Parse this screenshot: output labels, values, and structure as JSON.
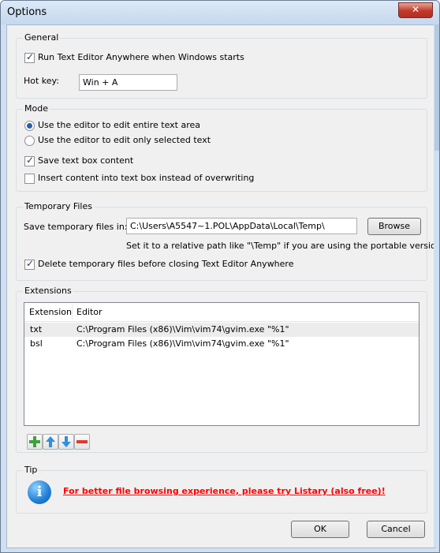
{
  "window": {
    "title": "Options",
    "close_label": "✕"
  },
  "general": {
    "title": "General",
    "run_on_start": {
      "label": "Run Text Editor Anywhere when Windows starts",
      "checked": true
    },
    "hotkey": {
      "label": "Hot key:",
      "value": "Win + A"
    }
  },
  "mode": {
    "title": "Mode",
    "radio_entire": {
      "label": "Use the editor to edit entire text area",
      "selected": true
    },
    "radio_selected": {
      "label": "Use the editor to edit only selected text",
      "selected": false
    },
    "save_content": {
      "label": "Save text box content",
      "checked": true
    },
    "insert_content": {
      "label": "Insert content into text box instead of overwriting",
      "checked": false
    }
  },
  "temp": {
    "title": "Temporary Files",
    "path_label": "Save temporary files in:",
    "path_value": "C:\\Users\\A5547~1.POL\\AppData\\Local\\Temp\\",
    "browse_label": "Browse",
    "hint": "Set it to a relative path like \"\\Temp\" if you are using the portable version.",
    "delete_before_close": {
      "label": "Delete temporary files before closing Text Editor Anywhere",
      "checked": true
    }
  },
  "extensions": {
    "title": "Extensions",
    "columns": [
      "Extension",
      "Editor"
    ],
    "rows": [
      {
        "ext": "txt",
        "editor": "C:\\Program Files (x86)\\Vim\\vim74\\gvim.exe \"%1\""
      },
      {
        "ext": "bsl",
        "editor": "C:\\Program Files (x86)\\Vim\\vim74\\gvim.exe \"%1\""
      }
    ],
    "toolbar_icons": [
      "add-icon",
      "arrow-up-icon",
      "arrow-down-icon",
      "remove-icon"
    ]
  },
  "tip": {
    "title": "Tip",
    "link_text": "For better file browsing experience, please try Listary (also free)!"
  },
  "buttons": {
    "ok": "OK",
    "cancel": "Cancel"
  },
  "colors": {
    "tip_link": "#ff0000",
    "accent": "#1f7fd6"
  }
}
